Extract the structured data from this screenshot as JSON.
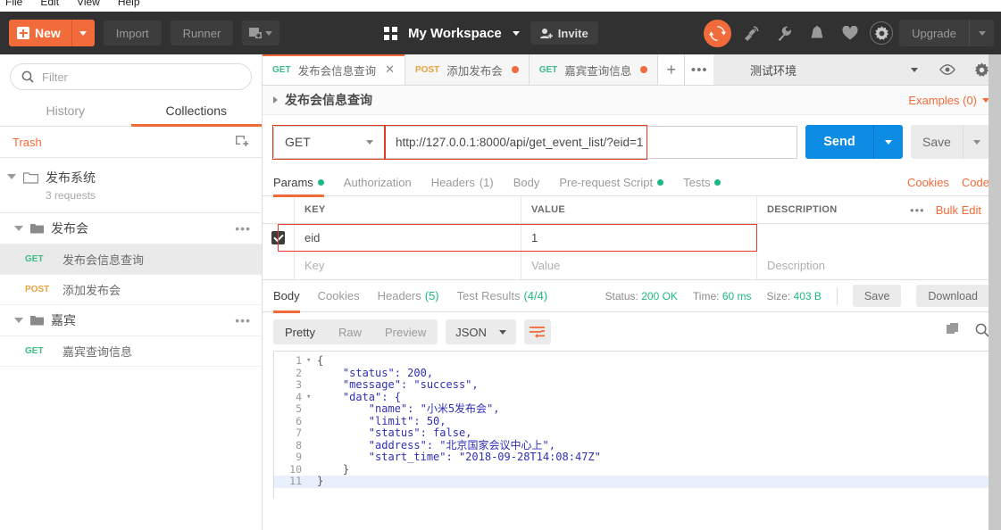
{
  "menubar": {
    "items": [
      "File",
      "Edit",
      "View",
      "Help"
    ]
  },
  "topbar": {
    "new_label": "New",
    "import_label": "Import",
    "runner_label": "Runner",
    "workspace_name": "My Workspace",
    "invite_label": "Invite",
    "upgrade_label": "Upgrade",
    "icons": [
      "sync-icon",
      "satellite-icon",
      "wrench-icon",
      "bell-icon",
      "heart-icon",
      "gear-icon"
    ],
    "accent_orange": "#f26b3a"
  },
  "sidebar": {
    "filter_placeholder": "Filter",
    "tabs": [
      {
        "label": "History",
        "active": false
      },
      {
        "label": "Collections",
        "active": true
      }
    ],
    "trash_label": "Trash",
    "collection": {
      "name": "发布系统",
      "requests_count": "3 requests"
    },
    "folders": [
      {
        "name": "发布会",
        "items": [
          {
            "method": "GET",
            "name": "发布会信息查询",
            "selected": true
          },
          {
            "method": "POST",
            "name": "添加发布会",
            "selected": false
          }
        ]
      },
      {
        "name": "嘉宾",
        "items": [
          {
            "method": "GET",
            "name": "嘉宾查询信息",
            "selected": false
          }
        ]
      }
    ]
  },
  "tabstrip": {
    "tabs": [
      {
        "method": "GET",
        "name": "发布会信息查询",
        "active": true,
        "dirty": false
      },
      {
        "method": "POST",
        "name": "添加发布会",
        "active": false,
        "dirty": true
      },
      {
        "method": "GET",
        "name": "嘉宾查询信息",
        "active": false,
        "dirty": true
      }
    ],
    "plus_label": "+",
    "more_label": "•••"
  },
  "environment": {
    "selected": "测试环境"
  },
  "request_header": {
    "title": "发布会信息查询",
    "examples_label": "Examples (0)"
  },
  "url_bar": {
    "method": "GET",
    "url": "http://127.0.0.1:8000/api/get_event_list/?eid=1",
    "send_label": "Send",
    "save_label": "Save",
    "highlight_color": "#e03b24"
  },
  "request_tabs": {
    "items": [
      {
        "label": "Params",
        "active": true,
        "dot": true,
        "count": ""
      },
      {
        "label": "Authorization",
        "active": false,
        "dot": false,
        "count": ""
      },
      {
        "label": "Headers",
        "active": false,
        "dot": false,
        "count": "(1)"
      },
      {
        "label": "Body",
        "active": false,
        "dot": false,
        "count": ""
      },
      {
        "label": "Pre-request Script",
        "active": false,
        "dot": true,
        "count": ""
      },
      {
        "label": "Tests",
        "active": false,
        "dot": true,
        "count": ""
      }
    ],
    "cookies_label": "Cookies",
    "code_label": "Code"
  },
  "params_table": {
    "headers": {
      "key": "KEY",
      "value": "VALUE",
      "description": "DESCRIPTION"
    },
    "bulk_edit_label": "Bulk Edit",
    "more_label": "•••",
    "rows": [
      {
        "checked": true,
        "key": "eid",
        "value": "1",
        "description": "",
        "highlighted": true
      }
    ],
    "placeholder_row": {
      "key": "Key",
      "value": "Value",
      "description": "Description"
    }
  },
  "response": {
    "tabs": [
      {
        "label": "Body",
        "active": true,
        "count": ""
      },
      {
        "label": "Cookies",
        "active": false,
        "count": ""
      },
      {
        "label": "Headers",
        "active": false,
        "count": "(5)"
      },
      {
        "label": "Test Results",
        "active": false,
        "count": "(4/4)"
      }
    ],
    "status_label": "Status:",
    "status_value": "200 OK",
    "time_label": "Time:",
    "time_value": "60 ms",
    "size_label": "Size:",
    "size_value": "403 B",
    "save_label": "Save",
    "download_label": "Download",
    "format_tabs": [
      {
        "label": "Pretty",
        "active": true
      },
      {
        "label": "Raw",
        "active": false
      },
      {
        "label": "Preview",
        "active": false
      }
    ],
    "format_type": "JSON",
    "wrap_icon": "word-wrap-icon",
    "copy_icon": "copy-icon",
    "search_icon": "search-icon",
    "body_lines": [
      {
        "num": "1",
        "fold": "▾",
        "text": "{",
        "highlighted": false
      },
      {
        "num": "2",
        "fold": "",
        "text": "    \"status\": 200,",
        "highlighted": false
      },
      {
        "num": "3",
        "fold": "",
        "text": "    \"message\": \"success\",",
        "highlighted": false
      },
      {
        "num": "4",
        "fold": "▾",
        "text": "    \"data\": {",
        "highlighted": false
      },
      {
        "num": "5",
        "fold": "",
        "text": "        \"name\": \"小米5发布会\",",
        "highlighted": false
      },
      {
        "num": "6",
        "fold": "",
        "text": "        \"limit\": 50,",
        "highlighted": false
      },
      {
        "num": "7",
        "fold": "",
        "text": "        \"status\": false,",
        "highlighted": false
      },
      {
        "num": "8",
        "fold": "",
        "text": "        \"address\": \"北京国家会议中心上\",",
        "highlighted": false
      },
      {
        "num": "9",
        "fold": "",
        "text": "        \"start_time\": \"2018-09-28T14:08:47Z\"",
        "highlighted": false
      },
      {
        "num": "10",
        "fold": "",
        "text": "    }",
        "highlighted": false
      },
      {
        "num": "11",
        "fold": "",
        "text": "}",
        "highlighted": true
      }
    ]
  }
}
